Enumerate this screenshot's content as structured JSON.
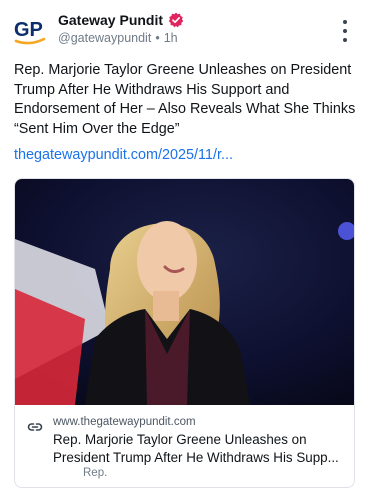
{
  "post": {
    "author": {
      "display_name": "Gateway Pundit",
      "handle": "@gatewaypundit",
      "separator": "•",
      "time": "1h",
      "avatar_text": "GP",
      "verified": true
    },
    "text": "Rep. Marjorie Taylor Greene Unleashes on President Trump After He Withdraws His Support and Endorsement of Her – Also Reveals What She Thinks “Sent Him Over the Edge”",
    "link_text": "thegatewaypundit.com/2025/11/r...",
    "menu_icon": "more-vertical-icon"
  },
  "link_card": {
    "domain": "www.thegatewaypundit.com",
    "title": "Rep. Marjorie Taylor Greene Unleashes on President Trump After He Withdraws His Supp...",
    "description": "Rep.",
    "icon": "link-icon"
  },
  "colors": {
    "link": "#1a73e8",
    "verified_badge": "#e0245e",
    "avatar_blue": "#0d2d6c",
    "avatar_orange": "#f5a623"
  }
}
